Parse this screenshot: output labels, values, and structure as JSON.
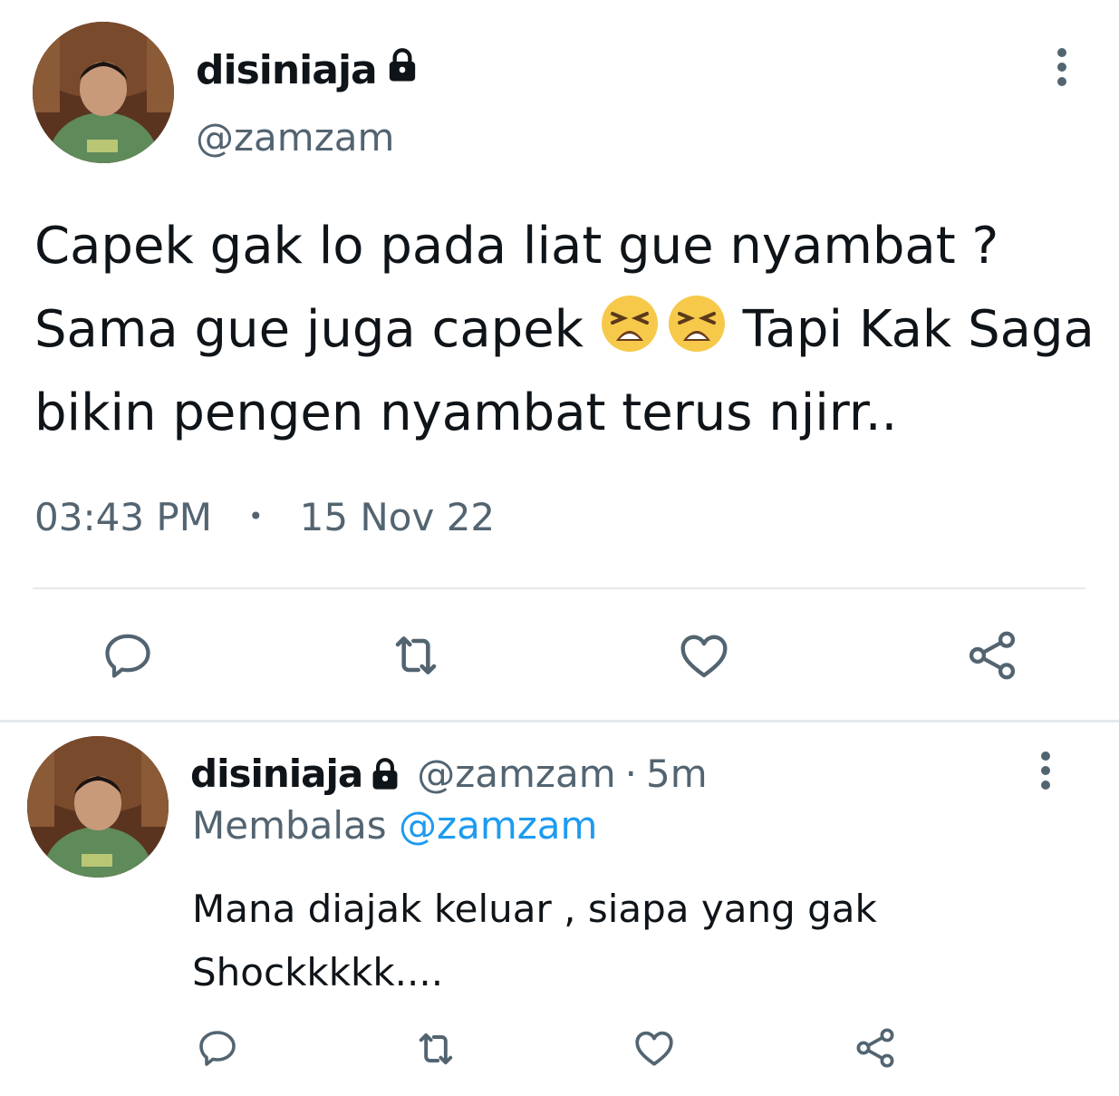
{
  "main_tweet": {
    "display_name": "disiniaja",
    "handle": "@zamzam",
    "text_line1": "Capek gak lo pada liat gue nyambat ?",
    "text_line2_before": "Sama gue juga capek ",
    "text_line2_after": " Tapi Kak Saga",
    "text_line3": "bikin pengen nyambat terus njirr..",
    "emoji": [
      "tired-face-emoji",
      "tired-face-emoji"
    ],
    "time": "03:43 PM",
    "separator": "•",
    "date": "15 Nov 22",
    "actions": [
      "reply-icon",
      "retweet-icon",
      "like-icon",
      "share-icon"
    ]
  },
  "reply_tweet": {
    "display_name": "disiniaja",
    "handle": "@zamzam",
    "dot": "·",
    "time": "5m",
    "replying_prefix": "Membalas",
    "replying_to": "@zamzam",
    "text_line1": "Mana diajak keluar , siapa yang gak",
    "text_line2": "Shockkkkk....",
    "actions": [
      "reply-icon",
      "retweet-icon",
      "like-icon",
      "share-icon"
    ]
  },
  "colors": {
    "text_primary": "#0f1419",
    "text_secondary": "#536471",
    "accent": "#1d9bf0",
    "divider": "#e6e9ec"
  }
}
